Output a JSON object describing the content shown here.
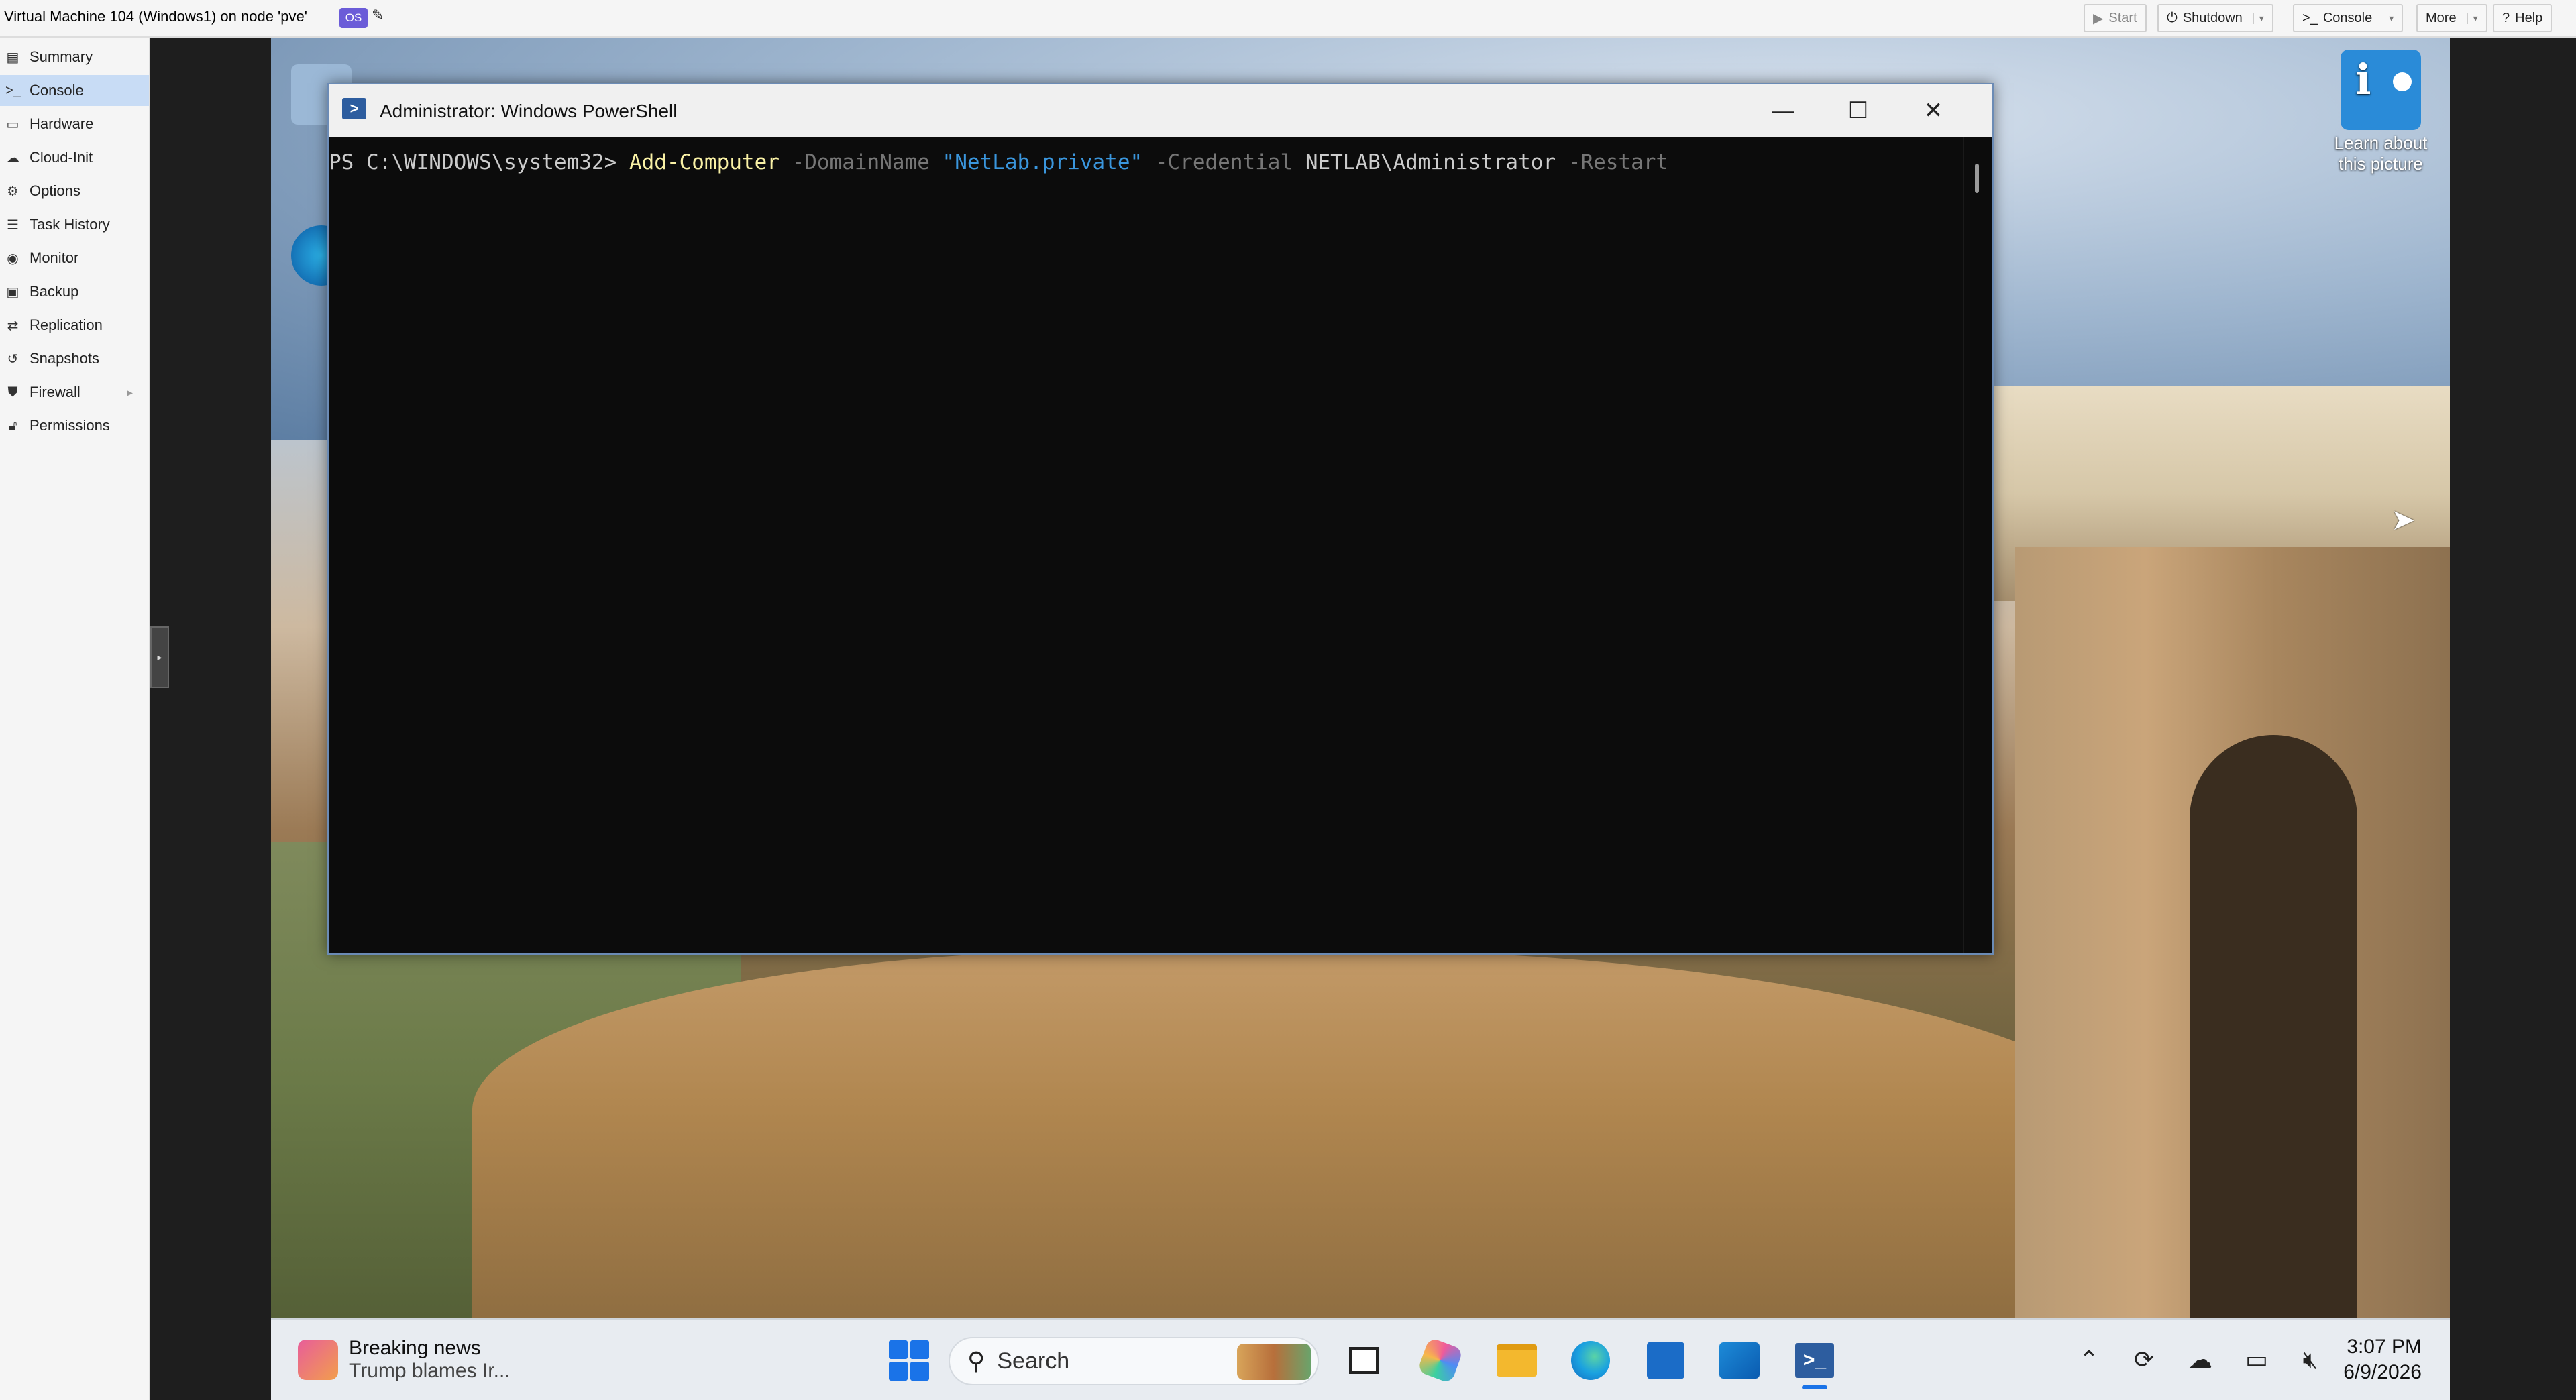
{
  "topbar": {
    "title": "Virtual Machine 104 (Windows1) on node 'pve'",
    "os_tag": "OS",
    "buttons": {
      "start": "Start",
      "shutdown": "Shutdown",
      "console": "Console",
      "more": "More",
      "help": "Help"
    }
  },
  "sidebar": {
    "items": [
      {
        "label": "Summary",
        "icon": "book-icon"
      },
      {
        "label": "Console",
        "icon": "terminal-icon",
        "active": true
      },
      {
        "label": "Hardware",
        "icon": "monitor-icon"
      },
      {
        "label": "Cloud-Init",
        "icon": "cloud-icon"
      },
      {
        "label": "Options",
        "icon": "gear-icon"
      },
      {
        "label": "Task History",
        "icon": "list-icon"
      },
      {
        "label": "Monitor",
        "icon": "eye-icon"
      },
      {
        "label": "Backup",
        "icon": "floppy-icon"
      },
      {
        "label": "Replication",
        "icon": "retweet-icon"
      },
      {
        "label": "Snapshots",
        "icon": "history-icon"
      },
      {
        "label": "Firewall",
        "icon": "shield-icon",
        "expandable": true
      },
      {
        "label": "Permissions",
        "icon": "unlock-icon"
      }
    ]
  },
  "desktop": {
    "learn_icon_label_1": "Learn about",
    "learn_icon_label_2": "this picture"
  },
  "powershell": {
    "title": "Administrator: Windows PowerShell",
    "prompt": "PS C:\\WINDOWS\\system32> ",
    "cmdlet": "Add-Computer",
    "param_domain": " -DomainName ",
    "domain_value": "\"NetLab.private\"",
    "param_credential": " -Credential ",
    "credential_value": "NETLAB\\Administrator",
    "param_restart": " -Restart"
  },
  "taskbar": {
    "news_title": "Breaking news",
    "news_subtitle": "Trump blames Ir...",
    "search_label": "Search",
    "clock_time": "3:07 PM",
    "clock_date": "6/9/2026"
  }
}
